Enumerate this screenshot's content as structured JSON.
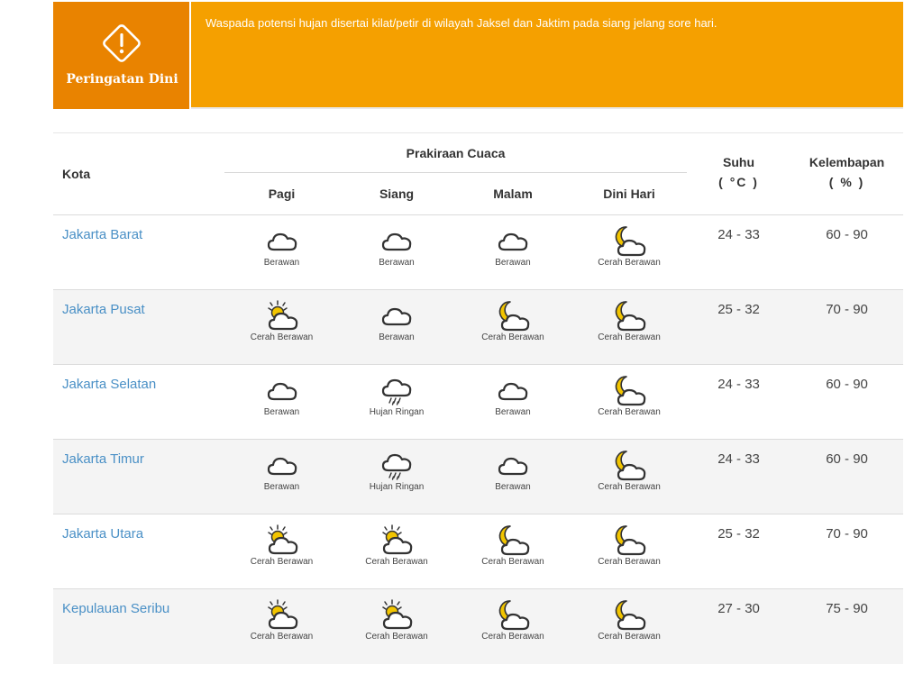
{
  "warning": {
    "title": "Peringatan Dini",
    "icon": "warning-diamond-icon",
    "message": "Waspada potensi hujan disertai kilat/petir di wilayah Jaksel dan Jaktim pada siang jelang sore hari.",
    "colors": {
      "label_bg": "#e98300",
      "banner_bg": "#f5a000"
    }
  },
  "table": {
    "headers": {
      "city": "Kota",
      "forecast": "Prakiraan Cuaca",
      "periods": [
        "Pagi",
        "Siang",
        "Malam",
        "Dini Hari"
      ],
      "temp": "Suhu",
      "temp_unit": "( °C )",
      "humidity": "Kelembapan",
      "humidity_unit": "( % )"
    },
    "rows": [
      {
        "city": "Jakarta Barat",
        "forecast": [
          {
            "icon": "cloudy-icon",
            "label": "Berawan"
          },
          {
            "icon": "cloudy-icon",
            "label": "Berawan"
          },
          {
            "icon": "cloudy-icon",
            "label": "Berawan"
          },
          {
            "icon": "moon-cloud-icon",
            "label": "Cerah Berawan"
          }
        ],
        "temp": "24 - 33",
        "humidity": "60 - 90"
      },
      {
        "city": "Jakarta Pusat",
        "forecast": [
          {
            "icon": "sun-cloud-icon",
            "label": "Cerah Berawan"
          },
          {
            "icon": "cloudy-icon",
            "label": "Berawan"
          },
          {
            "icon": "moon-cloud-icon",
            "label": "Cerah Berawan"
          },
          {
            "icon": "moon-cloud-icon",
            "label": "Cerah Berawan"
          }
        ],
        "temp": "25 - 32",
        "humidity": "70 - 90"
      },
      {
        "city": "Jakarta Selatan",
        "forecast": [
          {
            "icon": "cloudy-icon",
            "label": "Berawan"
          },
          {
            "icon": "light-rain-icon",
            "label": "Hujan Ringan"
          },
          {
            "icon": "cloudy-icon",
            "label": "Berawan"
          },
          {
            "icon": "moon-cloud-icon",
            "label": "Cerah Berawan"
          }
        ],
        "temp": "24 - 33",
        "humidity": "60 - 90"
      },
      {
        "city": "Jakarta Timur",
        "forecast": [
          {
            "icon": "cloudy-icon",
            "label": "Berawan"
          },
          {
            "icon": "light-rain-icon",
            "label": "Hujan Ringan"
          },
          {
            "icon": "cloudy-icon",
            "label": "Berawan"
          },
          {
            "icon": "moon-cloud-icon",
            "label": "Cerah Berawan"
          }
        ],
        "temp": "24 - 33",
        "humidity": "60 - 90"
      },
      {
        "city": "Jakarta Utara",
        "forecast": [
          {
            "icon": "sun-cloud-icon",
            "label": "Cerah Berawan"
          },
          {
            "icon": "sun-cloud-icon",
            "label": "Cerah Berawan"
          },
          {
            "icon": "moon-cloud-icon",
            "label": "Cerah Berawan"
          },
          {
            "icon": "moon-cloud-icon",
            "label": "Cerah Berawan"
          }
        ],
        "temp": "25 - 32",
        "humidity": "70 - 90"
      },
      {
        "city": "Kepulauan Seribu",
        "forecast": [
          {
            "icon": "sun-cloud-icon",
            "label": "Cerah Berawan"
          },
          {
            "icon": "sun-cloud-icon",
            "label": "Cerah Berawan"
          },
          {
            "icon": "moon-cloud-icon",
            "label": "Cerah Berawan"
          },
          {
            "icon": "moon-cloud-icon",
            "label": "Cerah Berawan"
          }
        ],
        "temp": "27 - 30",
        "humidity": "75 - 90"
      }
    ],
    "colors": {
      "city_link": "#4a90c6",
      "row_alt": "#f4f4f4",
      "sun": "#f2c500"
    }
  }
}
